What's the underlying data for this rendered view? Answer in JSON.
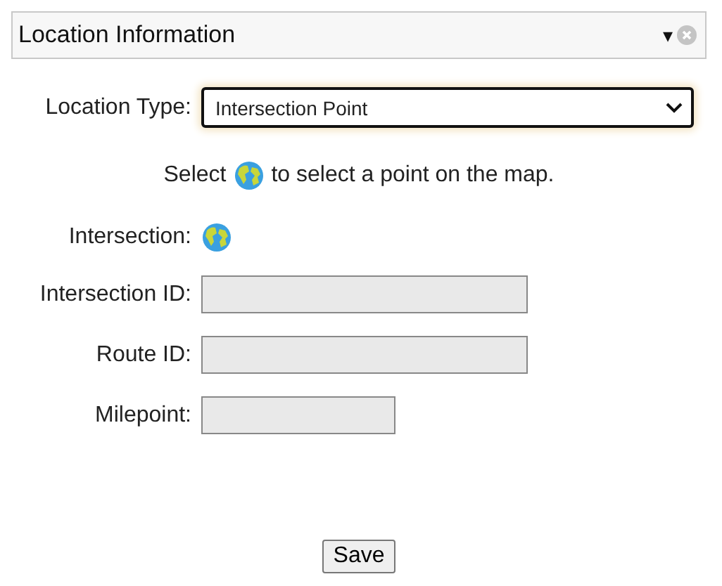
{
  "panel": {
    "title": "Location Information",
    "collapse_glyph": "▾"
  },
  "location_type": {
    "label": "Location Type:",
    "value": "Intersection Point"
  },
  "instruction": {
    "before": "Select",
    "after": "to select a point on the map."
  },
  "intersection": {
    "label": "Intersection:"
  },
  "fields": [
    {
      "label": "Intersection ID:",
      "kind": "long",
      "disabled": true
    },
    {
      "label": "Route ID:",
      "kind": "long",
      "disabled": true
    },
    {
      "label": "Milepoint:",
      "kind": "short",
      "disabled": true
    }
  ],
  "buttons": [
    "Save"
  ]
}
